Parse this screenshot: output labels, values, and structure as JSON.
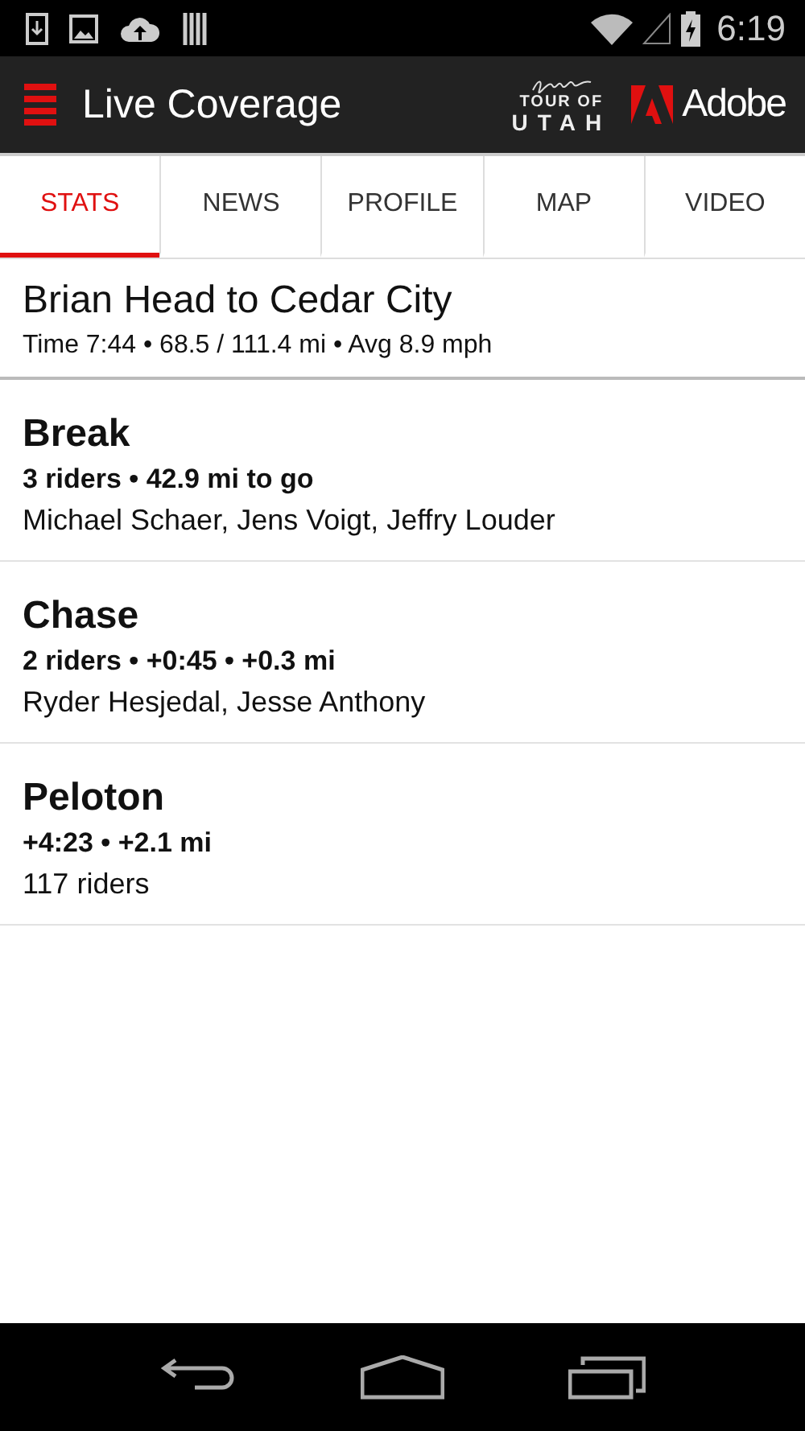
{
  "status_bar": {
    "time": "6:19"
  },
  "app_bar": {
    "title": "Live Coverage",
    "logos": [
      {
        "kind": "tour",
        "line_1": "TOUR OF",
        "line_2": "UTAH"
      },
      {
        "kind": "adobe",
        "text": "Adobe"
      }
    ]
  },
  "tabs": [
    {
      "label": "STATS",
      "selected": true
    },
    {
      "label": "NEWS",
      "selected": false
    },
    {
      "label": "PROFILE",
      "selected": false
    },
    {
      "label": "MAP",
      "selected": false
    },
    {
      "label": "VIDEO",
      "selected": false
    }
  ],
  "stage": {
    "title": "Brian Head to Cedar City",
    "summary": "Time 7:44 • 68.5 / 111.4 mi • Avg 8.9 mph"
  },
  "groups": [
    {
      "name": "Break",
      "gap": "3 riders • 42.9 mi to go",
      "riders": "Michael Schaer, Jens Voigt, Jeffry Louder"
    },
    {
      "name": "Chase",
      "gap": "2 riders • +0:45 • +0.3 mi",
      "riders": "Ryder Hesjedal, Jesse Anthony"
    },
    {
      "name": "Peloton",
      "gap": "+4:23 • +2.1 mi",
      "riders": "117 riders"
    }
  ]
}
